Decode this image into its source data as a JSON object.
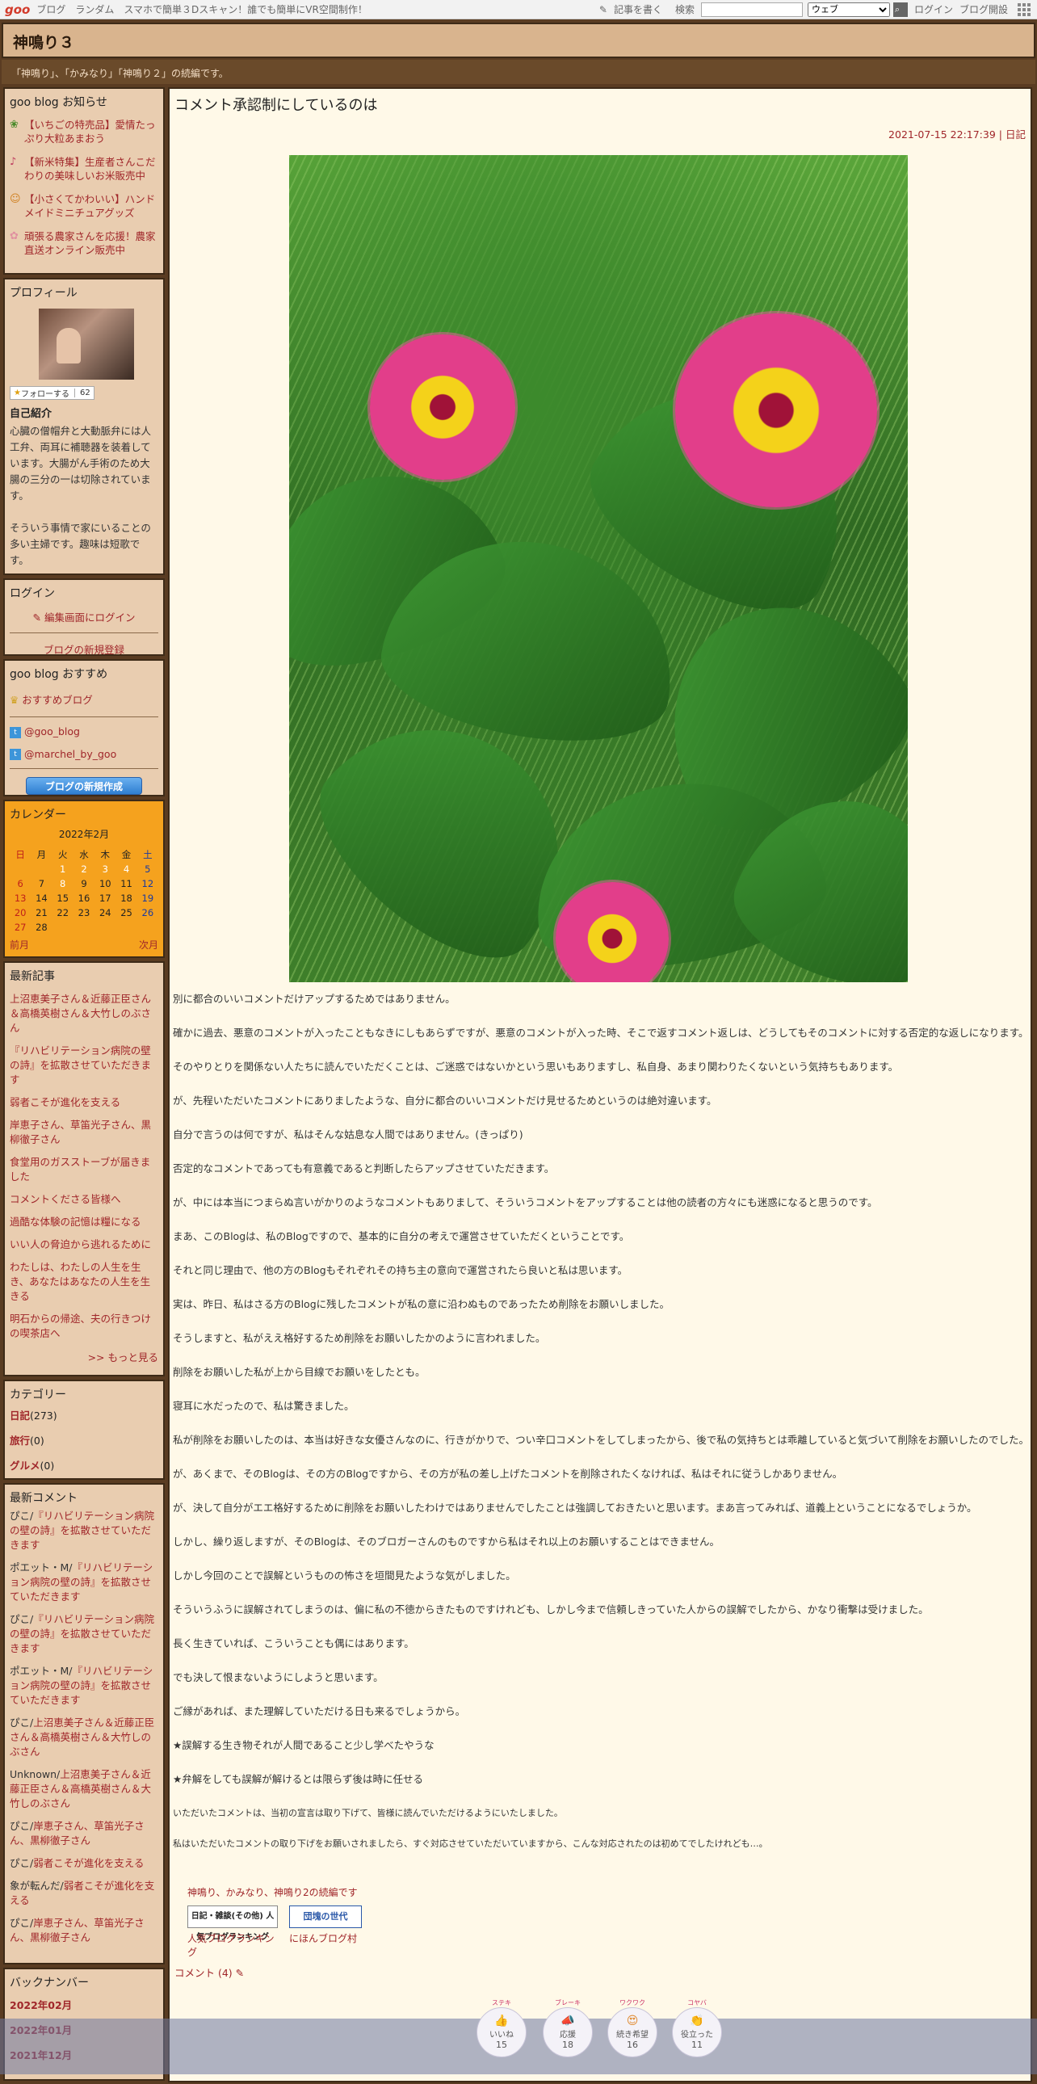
{
  "topbar": {
    "logo": "goo",
    "links": [
      "ブログ",
      "ランダム"
    ],
    "promo": "スマホで簡単３Dスキャン！誰でも簡単にVR空間制作！",
    "write_label": "記事を書く",
    "search_label": "検索",
    "search_value": "",
    "select_value": "ウェブ",
    "login_label": "ログイン",
    "open_blog_label": "ブログ開設"
  },
  "header": {
    "title": "神鳴り３",
    "description": "「神鳴り」、「かみなり」「神鳴り２」の続編です。"
  },
  "sidebar": {
    "notice": {
      "title": "goo blog お知らせ",
      "items": [
        "【いちごの特売品】愛情たっぷり大粒あまおう",
        "【新米特集】生産者さんこだわりの美味しいお米販売中",
        "【小さくてかわいい】ハンドメイドミニチュアグッズ",
        "頑張る農家さんを応援！農家直送オンライン販売中"
      ]
    },
    "profile": {
      "title": "プロフィール",
      "follow_label": "フォローする",
      "follow_count": "62",
      "intro_label": "自己紹介",
      "intro_text1": "心臓の僧帽弁と大動脈弁には人工弁、両耳に補聴器を装着しています。大腸がん手術のため大腸の三分の一は切除されています。",
      "intro_text2": "そういう事情で家にいることの多い主婦です。趣味は短歌です。"
    },
    "login": {
      "title": "ログイン",
      "edit_link": "編集画面にログイン",
      "register_link": "ブログの新規登録"
    },
    "recommend": {
      "title": "goo blog おすすめ",
      "item": "おすすめブログ",
      "twitter1": "@goo_blog",
      "twitter2": "@marchel_by_goo",
      "create_button": "ブログの新規作成"
    },
    "calendar": {
      "title": "カレンダー",
      "month": "2022年2月",
      "weekdays": [
        "日",
        "月",
        "火",
        "水",
        "木",
        "金",
        "土"
      ],
      "weeks": [
        [
          "",
          "",
          "1",
          "2",
          "3",
          "4",
          "5"
        ],
        [
          "6",
          "7",
          "8",
          "9",
          "10",
          "11",
          "12"
        ],
        [
          "13",
          "14",
          "15",
          "16",
          "17",
          "18",
          "19"
        ],
        [
          "20",
          "21",
          "22",
          "23",
          "24",
          "25",
          "26"
        ],
        [
          "27",
          "28",
          "",
          "",
          "",
          "",
          ""
        ]
      ],
      "prev": "前月",
      "next": "次月"
    },
    "recent": {
      "title": "最新記事",
      "items": [
        "上沼恵美子さん＆近藤正臣さん＆高橋英樹さん＆大竹しのぶさん",
        "『リハビリテーション病院の壁の詩』を拡散させていただきます",
        "弱者こそが進化を支える",
        "岸恵子さん、草笛光子さん、黒柳徹子さん",
        "食堂用のガスストーブが届きました",
        "コメントくださる皆様へ",
        "過酷な体験の記憶は糧になる",
        "いい人の脅迫から逃れるために",
        "わたしは、わたしの人生を生き、あなたはあなたの人生を生きる",
        "明石からの帰途、夫の行きつけの喫茶店へ"
      ],
      "more": ">> もっと見る"
    },
    "category": {
      "title": "カテゴリー",
      "items": [
        {
          "name": "日記",
          "count": "(273)"
        },
        {
          "name": "旅行",
          "count": "(0)"
        },
        {
          "name": "グルメ",
          "count": "(0)"
        }
      ]
    },
    "comments": {
      "title": "最新コメント",
      "items": [
        {
          "who": "ぴこ/",
          "what": "『リハビリテーション病院の壁の詩』を拡散させていただきます"
        },
        {
          "who": "ポエット・M/",
          "what": "『リハビリテーション病院の壁の詩』を拡散させていただきます"
        },
        {
          "who": "ぴこ/",
          "what": "『リハビリテーション病院の壁の詩』を拡散させていただきます"
        },
        {
          "who": "ポエット・M/",
          "what": "『リハビリテーション病院の壁の詩』を拡散させていただきます"
        },
        {
          "who": "ぴこ/",
          "what": "上沼恵美子さん＆近藤正臣さん＆高橋英樹さん＆大竹しのぶさん"
        },
        {
          "who": "Unknown/",
          "what": "上沼恵美子さん＆近藤正臣さん＆高橋英樹さん＆大竹しのぶさん"
        },
        {
          "who": "ぴこ/",
          "what": "岸恵子さん、草笛光子さん、黒柳徹子さん"
        },
        {
          "who": "ぴこ/",
          "what": "弱者こそが進化を支える"
        },
        {
          "who": "象が転んだ/",
          "what": "弱者こそが進化を支える"
        },
        {
          "who": "ぴこ/",
          "what": "岸恵子さん、草笛光子さん、黒柳徹子さん"
        }
      ]
    },
    "backnumber": {
      "title": "バックナンバー",
      "items": [
        "2022年02月",
        "2022年01月",
        "2021年12月"
      ]
    }
  },
  "post": {
    "title": "コメント承認制にしているのは",
    "date": "2021-07-15 22:17:39",
    "category": "日記",
    "paragraphs": [
      "別に都合のいいコメントだけアップするためではありません。",
      "確かに過去、悪意のコメントが入ったこともなきにしもあらずですが、悪意のコメントが入った時、そこで返すコメント返しは、どうしてもそのコメントに対する否定的な返しになります。",
      "そのやりとりを関係ない人たちに読んでいただくことは、ご迷惑ではないかという思いもありますし、私自身、あまり関わりたくないという気持ちもあります。",
      "が、先程いただいたコメントにありましたような、自分に都合のいいコメントだけ見せるためというのは絶対違います。",
      "自分で言うのは何ですが、私はそんな姑息な人間ではありません。(きっぱり)",
      "否定的なコメントであっても有意義であると判断したらアップさせていただきます。",
      "が、中には本当につまらぬ言いがかりのようなコメントもありまして、そういうコメントをアップすることは他の読者の方々にも迷惑になると思うのです。",
      "まあ、このBlogは、私のBlogですので、基本的に自分の考えで運営させていただくということです。",
      "それと同じ理由で、他の方のBlogもそれぞれその持ち主の意向で運営されたら良いと私は思います。",
      "実は、昨日、私はさる方のBlogに残したコメントが私の意に沿わぬものであったため削除をお願いしました。",
      "そうしますと、私がええ格好するため削除をお願いしたかのように言われました。",
      "削除をお願いした私が上から目線でお願いをしたとも。",
      "寝耳に水だったので、私は驚きました。",
      "私が削除をお願いしたのは、本当は好きな女優さんなのに、行きがかりで、つい辛口コメントをしてしまったから、後で私の気持ちとは乖離していると気づいて削除をお願いしたのでした。",
      "が、あくまで、そのBlogは、その方のBlogですから、その方が私の差し上げたコメントを削除されたくなければ、私はそれに従うしかありません。",
      "が、決して自分がエエ格好するために削除をお願いしたわけではありませんでしたことは強調しておきたいと思います。まあ言ってみれば、道義上ということになるでしょうか。",
      "しかし、繰り返しますが、そのBlogは、そのブロガーさんのものですから私はそれ以上のお願いすることはできません。",
      "しかし今回のことで誤解というものの怖さを垣間見たような気がしました。",
      "そういうふうに誤解されてしまうのは、偏に私の不徳からきたものですけれども、しかし今まで信頼しきっていた人からの誤解でしたから、かなり衝撃は受けました。",
      "長く生きていれば、こういうことも偶にはあります。",
      "でも決して恨まないようにしようと思います。",
      "ご縁があれば、また理解していただける日も来るでしょうから。",
      "★誤解する生き物それが人間であること少し学べたやうな",
      "★弁解をしても誤解が解けるとは限らず後は時に任せる"
    ],
    "small_paragraphs": [
      "いただいたコメントは、当初の宣言は取り下げて、皆様に読んでいただけるようにいたしました。",
      "私はいただいたコメントの取り下げをお願いされましたら、すぐ対応させていただいていますから、こんな対応されたのは初めてでしたけれども…。"
    ],
    "banner_title": "神鳴り、かみなり、神鳴り2の続編です",
    "banner1_text": "日記・雑談(その他) 人気ブログランキング",
    "banner1_caption": "人気ブログランキング",
    "banner2_text": "団塊の世代",
    "banner2_caption": "にほんブログ村",
    "comment_link": "コメント (4)"
  },
  "reactions": [
    {
      "small": "ステキ",
      "label": "いいね",
      "count": "15"
    },
    {
      "small": "ブレーキ",
      "label": "応援",
      "count": "18"
    },
    {
      "small": "ワクワク",
      "label": "続き希望",
      "count": "16"
    },
    {
      "small": "コヤバ",
      "label": "役立った",
      "count": "11"
    }
  ]
}
